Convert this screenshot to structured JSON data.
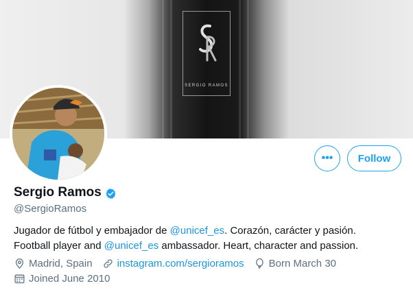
{
  "banner": {
    "brand_text": "SERGIO RAMOS"
  },
  "actions": {
    "more_label": "•••",
    "follow_label": "Follow"
  },
  "profile": {
    "name": "Sergio Ramos",
    "handle": "@SergioRamos",
    "verified": true,
    "bio_line1": {
      "before": "Jugador de fútbol y embajador de ",
      "mention": "@unicef_es",
      "after": ". Corazón, carácter y pasión."
    },
    "bio_line2": {
      "before": "Football player and ",
      "mention": "@unicef_es",
      "after": " ambassador. Heart, character and passion."
    },
    "location": "Madrid, Spain",
    "website": "instagram.com/sergioramos",
    "birthday": "Born March 30",
    "joined": "Joined June 2010"
  },
  "colors": {
    "accent": "#1da1f2",
    "link": "#1b95e0",
    "secondary_text": "#5b7083"
  },
  "icons": {
    "verified": "verified-badge-icon",
    "more": "more-options-icon",
    "location": "location-pin-icon",
    "website": "link-icon",
    "birthday": "balloon-icon",
    "joined": "calendar-icon"
  }
}
